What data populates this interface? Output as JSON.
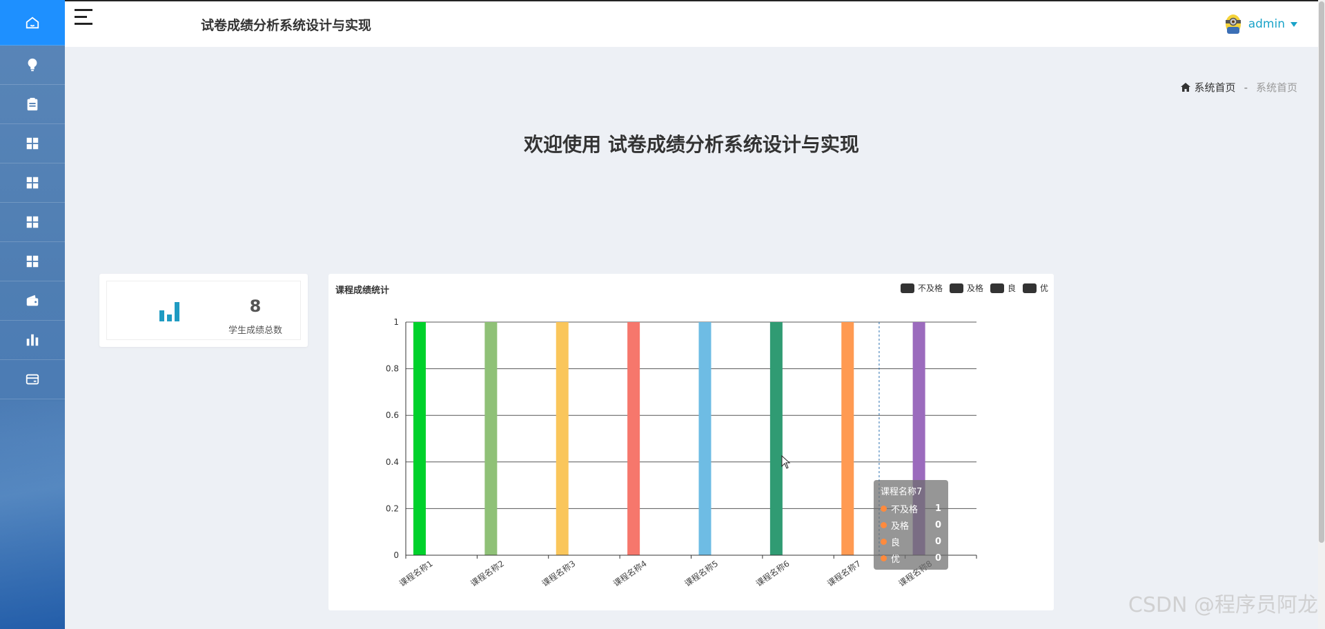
{
  "app": {
    "title": "试卷成绩分析系统设计与实现",
    "welcome": "欢迎使用 试卷成绩分析系统设计与实现"
  },
  "sidebar": {
    "items": [
      {
        "icon": "home-icon",
        "active": true
      },
      {
        "icon": "lightbulb-icon"
      },
      {
        "icon": "clipboard-icon"
      },
      {
        "icon": "grid-icon"
      },
      {
        "icon": "grid-icon"
      },
      {
        "icon": "grid-icon"
      },
      {
        "icon": "grid-icon"
      },
      {
        "icon": "wallet-icon"
      },
      {
        "icon": "bar-chart-icon"
      },
      {
        "icon": "card-icon"
      }
    ]
  },
  "header": {
    "user": "admin"
  },
  "breadcrumb": {
    "home": "系统首页",
    "current": "系统首页"
  },
  "stat": {
    "value": "8",
    "label": "学生成绩总数"
  },
  "chart_card": {
    "title": "课程成绩统计",
    "legend": [
      "不及格",
      "及格",
      "良",
      "优"
    ]
  },
  "tooltip": {
    "title": "课程名称7",
    "rows": [
      {
        "label": "不及格",
        "value": "1"
      },
      {
        "label": "及格",
        "value": "0"
      },
      {
        "label": "良",
        "value": "0"
      },
      {
        "label": "优",
        "value": "0"
      }
    ]
  },
  "watermark": "CSDN @程序员阿龙",
  "chart_data": {
    "type": "bar",
    "title": "课程成绩统计",
    "categories": [
      "课程名称1",
      "课程名称2",
      "课程名称3",
      "课程名称4",
      "课程名称5",
      "课程名称6",
      "课程名称7",
      "课程名称8"
    ],
    "series": [
      {
        "name": "不及格",
        "values": [
          1,
          1,
          1,
          1,
          1,
          1,
          1,
          1
        ]
      },
      {
        "name": "及格",
        "values": [
          0,
          0,
          0,
          0,
          0,
          0,
          0,
          0
        ]
      },
      {
        "name": "良",
        "values": [
          0,
          0,
          0,
          0,
          0,
          0,
          0,
          0
        ]
      },
      {
        "name": "优",
        "values": [
          0,
          0,
          0,
          0,
          0,
          0,
          0,
          0
        ]
      }
    ],
    "bar_colors": [
      "#00d12b",
      "#8fc177",
      "#fac65b",
      "#f6776c",
      "#6ebce4",
      "#309b73",
      "#ff9a52",
      "#9b6bbd"
    ],
    "ylim": [
      0,
      1
    ],
    "yticks": [
      0,
      0.2,
      0.4,
      0.6,
      0.8,
      1
    ],
    "grid": true,
    "legend_position": "top-right"
  }
}
